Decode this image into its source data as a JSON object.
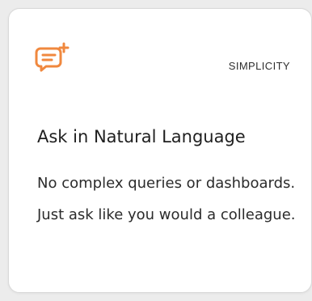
{
  "card": {
    "icon": "chat-plus-icon",
    "icon_color": "#f0883e",
    "badge": "SIMPLICITY",
    "title": "Ask in Natural Language",
    "description": "No complex queries or dashboards. Just ask like you would a colleague."
  }
}
